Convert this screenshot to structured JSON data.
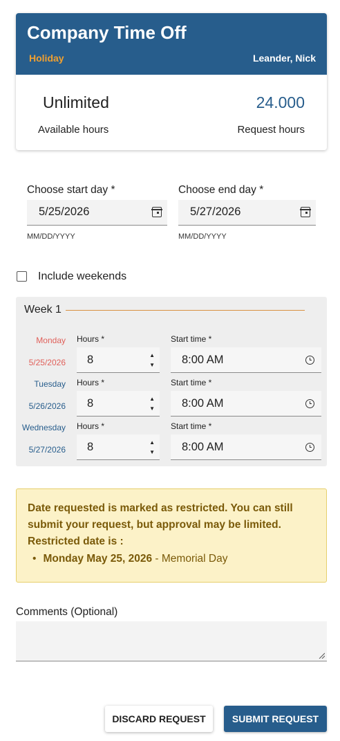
{
  "header": {
    "title": "Company Time Off",
    "leave_type": "Holiday",
    "employee": "Leander, Nick"
  },
  "summary": {
    "available_value": "Unlimited",
    "available_label": "Available hours",
    "request_value": "24.000",
    "request_label": "Request hours"
  },
  "dates": {
    "start_label": "Choose start day *",
    "start_value": "5/25/2026",
    "start_hint": "MM/DD/YYYY",
    "end_label": "Choose end day *",
    "end_value": "5/27/2026",
    "end_hint": "MM/DD/YYYY"
  },
  "weekends": {
    "label": "Include weekends",
    "checked": false
  },
  "week": {
    "title": "Week 1",
    "hours_label": "Hours *",
    "start_time_label": "Start time *",
    "days": [
      {
        "name": "Monday",
        "date": "5/25/2026",
        "hours": "8",
        "start_time": "8:00 AM",
        "restricted": true
      },
      {
        "name": "Tuesday",
        "date": "5/26/2026",
        "hours": "8",
        "start_time": "8:00 AM",
        "restricted": false
      },
      {
        "name": "Wednesday",
        "date": "5/27/2026",
        "hours": "8",
        "start_time": "8:00 AM",
        "restricted": false
      }
    ]
  },
  "warning": {
    "line1": "Date requested is marked as restricted. You can still",
    "line2": "submit your request, but approval may be limited.",
    "line3": "Restricted date is :",
    "item_date": "Monday May 25, 2026",
    "item_sep": " - ",
    "item_holiday": "Memorial Day"
  },
  "comments": {
    "label": "Comments (Optional)",
    "value": ""
  },
  "actions": {
    "discard": "DISCARD REQUEST",
    "submit": "SUBMIT REQUEST"
  },
  "colors": {
    "primary": "#275d8c",
    "accent": "#f0a030",
    "restricted_day": "#e0605a",
    "normal_day": "#275d8c"
  }
}
